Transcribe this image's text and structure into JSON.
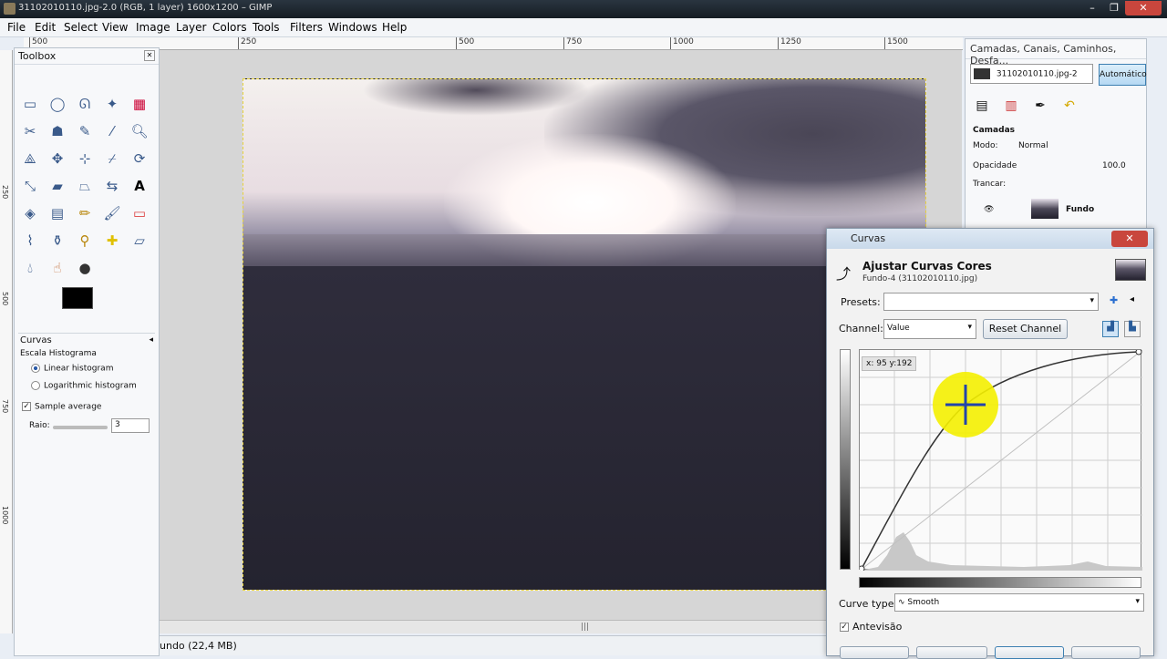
{
  "window": {
    "title": "31102010110.jpg-2.0 (RGB, 1 layer) 1600x1200 – GIMP"
  },
  "menu": [
    "File",
    "Edit",
    "Select",
    "View",
    "Image",
    "Layer",
    "Colors",
    "Tools",
    "Filters",
    "Windows",
    "Help"
  ],
  "ruler": {
    "h_ticks": [
      "500",
      "250",
      "500",
      "750",
      "1000",
      "1250",
      "1500"
    ],
    "v_ticks": [
      "250",
      "500",
      "750",
      "1000"
    ]
  },
  "toolbox": {
    "title": "Toolbox",
    "options": {
      "title": "Curvas",
      "histogram_label": "Escala Histograma",
      "linear": "Linear histogram",
      "log": "Logarithmic histogram",
      "sample_average": "Sample average",
      "radius_label": "Raio:",
      "radius_value": "3"
    }
  },
  "status": {
    "text": "undo (22,4 MB)"
  },
  "layers": {
    "title": "Camadas, Canais, Caminhos, Desfa...",
    "image_select": "31102010110.jpg-2",
    "auto_button": "Automático",
    "section": "Camadas",
    "mode_label": "Modo:",
    "mode_value": "Normal",
    "opacity_label": "Opacidade",
    "opacity_value": "100.0",
    "lock_label": "Trancar:",
    "layer_name": "Fundo"
  },
  "curves": {
    "window_title": "Curvas",
    "heading": "Ajustar Curvas Cores",
    "subheading": "Fundo-4 (31102010110.jpg)",
    "presets_label": "Presets:",
    "channel_label": "Channel:",
    "channel_value": "Value",
    "reset_button": "Reset Channel",
    "readout": "x: 95 y:192",
    "curve_type_label": "Curve type:",
    "curve_type_value": "Smooth",
    "preview_label": "Antevisão"
  }
}
